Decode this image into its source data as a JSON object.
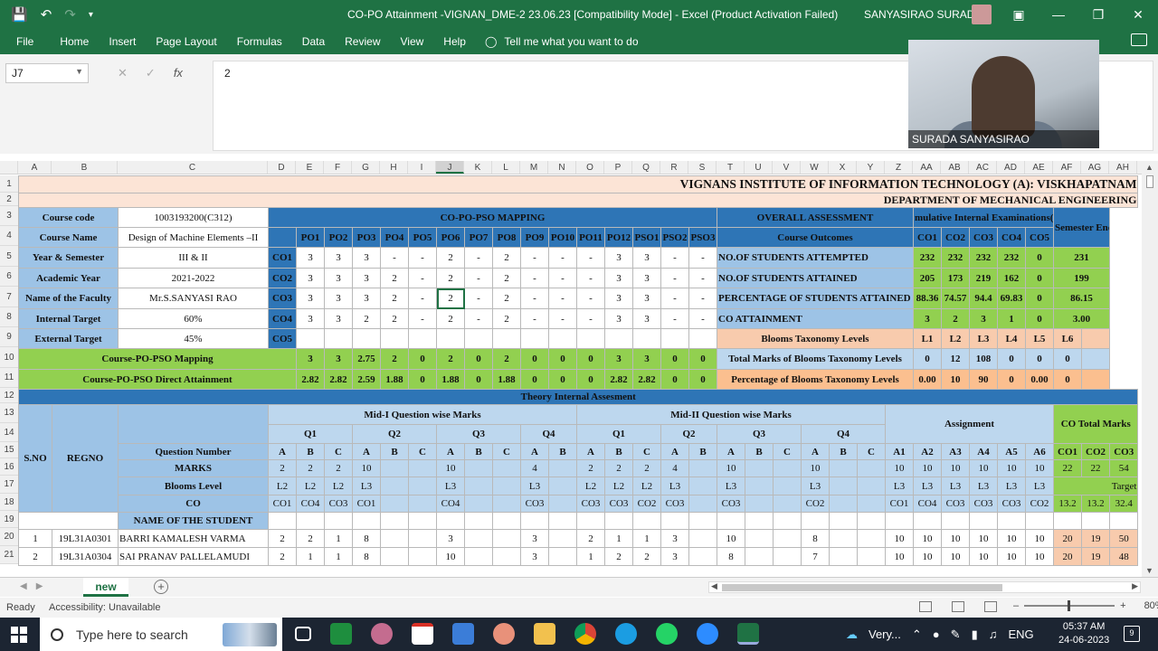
{
  "window": {
    "title": "CO-PO Attainment -VIGNAN_DME-2 23.06.23  [Compatibility Mode]  -  Excel (Product Activation Failed)",
    "user_name": "SANYASIRAO SURADA",
    "qat_icons": [
      "save-icon",
      "undo-icon",
      "redo-icon",
      "customize-qat-icon"
    ]
  },
  "ribbon": {
    "tabs": [
      "File",
      "Home",
      "Insert",
      "Page Layout",
      "Formulas",
      "Data",
      "Review",
      "View",
      "Help"
    ],
    "tell_me": "Tell me what you want to do"
  },
  "formula_bar": {
    "name_box": "J7",
    "fx": "fx",
    "value": "2"
  },
  "webcam": {
    "name": "SURADA SANYASIRAO"
  },
  "columns": [
    "A",
    "B",
    "C",
    "D",
    "E",
    "F",
    "G",
    "H",
    "I",
    "J",
    "K",
    "L",
    "M",
    "N",
    "O",
    "P",
    "Q",
    "R",
    "S",
    "T",
    "U",
    "V",
    "W",
    "X",
    "Y",
    "Z",
    "AA",
    "AB",
    "AC",
    "AD",
    "AE",
    "AF",
    "AG",
    "AH"
  ],
  "rows": [
    "1",
    "2",
    "3",
    "4",
    "5",
    "6",
    "7",
    "8",
    "9",
    "10",
    "11",
    "12",
    "13",
    "14",
    "15",
    "16",
    "17",
    "18",
    "19",
    "20",
    "21"
  ],
  "sheet": {
    "institute": "VIGNANS INSTITUTE OF INFORMATION TECHNOLOGY (A): VISKHAPATNAM",
    "department": "DEPARTMENT OF MECHANICAL ENGINEERING",
    "course_info": [
      {
        "label": "Course code",
        "value": "1003193200(C312)"
      },
      {
        "label": "Course Name",
        "value": "Design of Machine Elements –II"
      },
      {
        "label": "Year & Semester",
        "value": "III & II"
      },
      {
        "label": "Academic  Year",
        "value": "2021-2022"
      },
      {
        "label": "Name of the Faculty",
        "value": "Mr.S.SANYASI RAO"
      },
      {
        "label": "Internal Target",
        "value": "60%"
      },
      {
        "label": "External Target",
        "value": "45%"
      }
    ],
    "mapping_title": "CO-PO-PSO MAPPING",
    "po_headers": [
      "PO1",
      "PO2",
      "PO3",
      "PO4",
      "PO5",
      "PO6",
      "PO7",
      "PO8",
      "PO9",
      "PO10",
      "PO11",
      "PO12",
      "PSO1",
      "PSO2",
      "PSO3"
    ],
    "co_rows": [
      {
        "co": "CO1",
        "v": [
          "3",
          "3",
          "3",
          "-",
          "-",
          "2",
          "-",
          "2",
          "-",
          "-",
          "-",
          "3",
          "3",
          "-",
          "-"
        ]
      },
      {
        "co": "CO2",
        "v": [
          "3",
          "3",
          "3",
          "2",
          "-",
          "2",
          "-",
          "2",
          "-",
          "-",
          "-",
          "3",
          "3",
          "-",
          "-"
        ]
      },
      {
        "co": "CO3",
        "v": [
          "3",
          "3",
          "3",
          "2",
          "-",
          "2",
          "-",
          "2",
          "-",
          "-",
          "-",
          "3",
          "3",
          "-",
          "-"
        ]
      },
      {
        "co": "CO4",
        "v": [
          "3",
          "3",
          "2",
          "2",
          "-",
          "2",
          "-",
          "2",
          "-",
          "-",
          "-",
          "3",
          "3",
          "-",
          "-"
        ]
      },
      {
        "co": "CO5",
        "v": [
          "",
          "",
          "",
          "",
          "",
          "",
          "",
          "",
          "",
          "",
          "",
          "",
          "",
          "",
          ""
        ]
      }
    ],
    "course_mapping_label": "Course-PO-PSO Mapping",
    "course_mapping": [
      "3",
      "3",
      "2.75",
      "2",
      "0",
      "2",
      "0",
      "2",
      "0",
      "0",
      "0",
      "3",
      "3",
      "0",
      "0"
    ],
    "direct_attainment_label": "Course-PO-PSO Direct Attainment",
    "direct_attainment": [
      "2.82",
      "2.82",
      "2.59",
      "1.88",
      "0",
      "1.88",
      "0",
      "1.88",
      "0",
      "0",
      "0",
      "2.82",
      "2.82",
      "0",
      "0"
    ],
    "overall": {
      "title": "OVERALL ASSESSMENT",
      "cie_title": "mulative Internal Examinations(C",
      "see_title": "Semester End Examinations (SEE)",
      "course_outcomes_label": "Course Outcomes",
      "co_headers": [
        "CO1",
        "CO2",
        "CO3",
        "CO4",
        "CO5"
      ],
      "rows": [
        {
          "label": "NO.OF STUDENTS ATTEMPTED",
          "v": [
            "232",
            "232",
            "232",
            "232",
            "0"
          ],
          "see": "231"
        },
        {
          "label": "NO.OF STUDENTS ATTAINED",
          "v": [
            "205",
            "173",
            "219",
            "162",
            "0"
          ],
          "see": "199"
        },
        {
          "label": "PERCENTAGE OF STUDENTS ATTAINED",
          "v": [
            "88.36",
            "74.57",
            "94.4",
            "69.83",
            "0"
          ],
          "see": "86.15"
        },
        {
          "label": "CO ATTAINMENT",
          "v": [
            "3",
            "2",
            "3",
            "1",
            "0"
          ],
          "see": "3.00"
        }
      ],
      "blooms_label": "Blooms Taxonomy Levels",
      "blooms_levels": [
        "L1",
        "L2",
        "L3",
        "L4",
        "L5",
        "L6"
      ],
      "blooms_marks_label": "Total Marks of Blooms Taxonomy Levels",
      "blooms_marks": [
        "0",
        "12",
        "108",
        "0",
        "0",
        "0"
      ],
      "blooms_pct_label": "Percentage of Blooms Taxonomy Levels",
      "blooms_pct": [
        "0.00",
        "10",
        "90",
        "0",
        "0.00",
        "0"
      ]
    },
    "theory_title": "Theory Internal Assesment",
    "sno_label": "S.NO",
    "regno_label": "REGNO",
    "mid1_title": "Mid-I Question wise Marks",
    "mid2_title": "Mid-II Question wise Marks",
    "assignment_title": "Assignment",
    "co_total_title": "CO Total Marks",
    "question_groups": [
      "Q1",
      "Q2",
      "Q3",
      "Q4",
      "Q1",
      "Q2",
      "Q3",
      "Q4"
    ],
    "question_number_label": "Question Number",
    "marks_label": "MARKS",
    "blooms_level_label": "Blooms Level",
    "co_label": "CO",
    "name_label": "NAME OF THE STUDENT",
    "target_label": "Target",
    "qnum": [
      "A",
      "B",
      "C",
      "A",
      "B",
      "C",
      "A",
      "B",
      "C",
      "A",
      "B",
      "A",
      "B",
      "C",
      "A",
      "B",
      "A",
      "B",
      "C",
      "A",
      "B",
      "C",
      "A1",
      "A2",
      "A3",
      "A4",
      "A5",
      "A6",
      "CO1",
      "CO2",
      "CO3"
    ],
    "marks": [
      "2",
      "2",
      "2",
      "10",
      "",
      "",
      "10",
      "",
      "",
      "4",
      "",
      "2",
      "2",
      "2",
      "4",
      "",
      "10",
      "",
      "",
      "10",
      "",
      "",
      "10",
      "10",
      "10",
      "10",
      "10",
      "10",
      "22",
      "22",
      "54"
    ],
    "blooms": [
      "L2",
      "L2",
      "L2",
      "L3",
      "",
      "",
      "L3",
      "",
      "",
      "L3",
      "",
      "L2",
      "L2",
      "L2",
      "L3",
      "",
      "L3",
      "",
      "",
      "L3",
      "",
      "",
      "L3",
      "L3",
      "L3",
      "L3",
      "L3",
      "L3",
      "",
      "",
      ""
    ],
    "co": [
      "CO1",
      "CO4",
      "CO3",
      "CO1",
      "",
      "",
      "CO4",
      "",
      "",
      "CO3",
      "",
      "CO3",
      "CO3",
      "CO2",
      "CO3",
      "",
      "CO3",
      "",
      "",
      "CO2",
      "",
      "",
      "CO1",
      "CO4",
      "CO3",
      "CO3",
      "CO3",
      "CO2",
      "13.2",
      "13.2",
      "32.4"
    ],
    "students": [
      {
        "sno": "1",
        "regno": "19L31A0301",
        "name": "BARRI KAMALESH VARMA",
        "m": [
          "2",
          "2",
          "1",
          "8",
          "",
          "",
          "3",
          "",
          "",
          "3",
          "",
          "2",
          "1",
          "1",
          "3",
          "",
          "10",
          "",
          "",
          "8",
          "",
          "",
          "10",
          "10",
          "10",
          "10",
          "10",
          "10",
          "20",
          "19",
          "50"
        ]
      },
      {
        "sno": "2",
        "regno": "19L31A0304",
        "name": "SAI PRANAV PALLELAMUDI",
        "m": [
          "2",
          "1",
          "1",
          "8",
          "",
          "",
          "10",
          "",
          "",
          "3",
          "",
          "1",
          "2",
          "2",
          "3",
          "",
          "8",
          "",
          "",
          "7",
          "",
          "",
          "10",
          "10",
          "10",
          "10",
          "10",
          "10",
          "20",
          "19",
          "48"
        ]
      }
    ]
  },
  "sheet_tabs": {
    "active": "new"
  },
  "status": {
    "ready": "Ready",
    "accessibility": "Accessibility: Unavailable",
    "zoom": "80%"
  },
  "taskbar": {
    "search_placeholder": "Type here to search",
    "weather": "Very...",
    "lang": "ENG",
    "time": "05:37 AM",
    "date": "24-06-2023",
    "notifications": "9"
  }
}
